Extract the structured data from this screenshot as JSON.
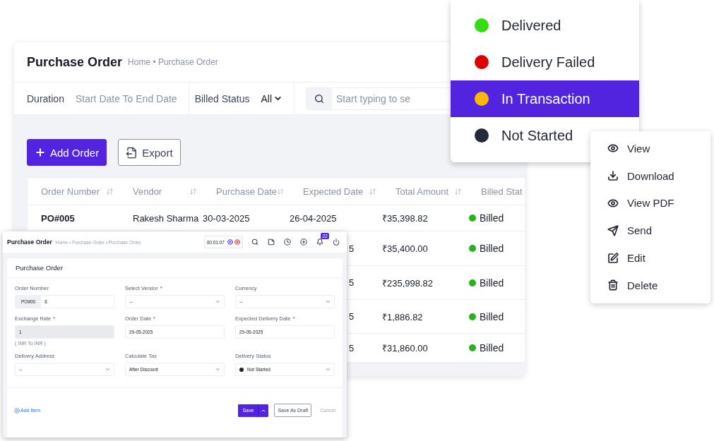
{
  "main": {
    "title": "Purchase Order",
    "breadcrumb": "Home • Purchase Order",
    "filters": {
      "duration_label": "Duration",
      "duration_placeholder": "Start Date To End Date",
      "billed_label": "Billed Status",
      "billed_value": "All",
      "search_placeholder": "Start typing to se"
    },
    "buttons": [
      {
        "kind": "add",
        "label": "Add Order"
      },
      {
        "kind": "export",
        "label": "Export"
      }
    ],
    "table": {
      "columns": [
        "Order Number",
        "Vendor",
        "Purchase Date",
        "Expected Date",
        "Total Amount",
        "Billed Stat"
      ],
      "rows": [
        {
          "order_number": "PO#005",
          "vendor": "Rakesh Sharma",
          "purchase_date": "30-03-2025",
          "expected_date": "26-04-2025",
          "total_amount": "₹35,398.82",
          "billed_status": "Billed",
          "color": "#27b31c"
        },
        {
          "expected_date": "5",
          "total_amount": "₹35,400.00",
          "billed_status": "Billed",
          "color": "#27b31c"
        },
        {
          "expected_date": "5",
          "total_amount": "₹235,998.82",
          "billed_status": "Billed",
          "color": "#27b31c"
        },
        {
          "expected_date": "5",
          "total_amount": "₹1,886.82",
          "billed_status": "Billed",
          "color": "#27b31c"
        },
        {
          "expected_date": "5",
          "total_amount": "₹31,860.00",
          "billed_status": "Billed",
          "color": "#27b31c"
        }
      ]
    }
  },
  "status_menu": [
    {
      "label": "Delivered",
      "color": "#33dd11",
      "selected": false
    },
    {
      "label": "Delivery Failed",
      "color": "#dd0000",
      "selected": false
    },
    {
      "label": "In Transaction",
      "color": "#ffb800",
      "selected": true
    },
    {
      "label": "Not Started",
      "color": "#232a38",
      "selected": false
    }
  ],
  "action_menu": [
    {
      "kind": "view",
      "label": "View"
    },
    {
      "kind": "download",
      "label": "Download"
    },
    {
      "kind": "pdf",
      "label": "View PDF"
    },
    {
      "kind": "send",
      "label": "Send"
    },
    {
      "kind": "edit",
      "label": "Edit"
    },
    {
      "kind": "delete",
      "label": "Delete"
    }
  ],
  "form_window": {
    "title": "Purchase Order",
    "breadcrumb": "Home • Purchase Order • Purchase Order",
    "timer": "00:01:07",
    "notification_count": "22",
    "card_title": "Purchase Order",
    "fields": [
      {
        "kind": "prefixed",
        "label": "Order Number",
        "required": false,
        "prefix": "PO#00",
        "value": "6"
      },
      {
        "kind": "select",
        "label": "Select Vendor",
        "required": true,
        "value": "--"
      },
      {
        "kind": "select",
        "label": "Currency",
        "required": false,
        "value": "--"
      },
      {
        "kind": "text",
        "label": "Exchange Rate",
        "required": true,
        "value": "1",
        "disabled": true,
        "hint": "( INR To INR )"
      },
      {
        "kind": "text",
        "label": "Order Date",
        "required": true,
        "value": "29-05-2025",
        "disabled": false
      },
      {
        "kind": "text",
        "label": "Expected Delivery Date",
        "required": true,
        "value": "29-05-2025",
        "disabled": false
      },
      {
        "kind": "select",
        "label": "Delivery Address",
        "required": false,
        "value": "--"
      },
      {
        "kind": "select",
        "label": "Calculate Tax",
        "required": false,
        "value": "After Discount"
      },
      {
        "kind": "status",
        "label": "Delivery Status",
        "required": false,
        "value": "Not Started",
        "color": "#1f2430"
      }
    ],
    "required_mark": "*",
    "add_item": "Add Item",
    "save": "Save",
    "save_draft": "Save As Draft",
    "cancel": "Cancel"
  }
}
